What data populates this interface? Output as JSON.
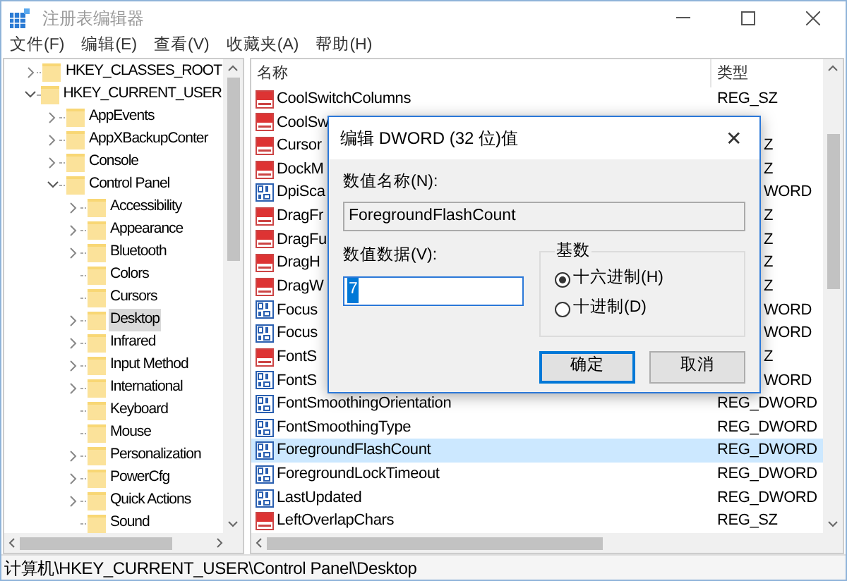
{
  "window": {
    "title": "注册表编辑器",
    "active": false
  },
  "menu": [
    "文件(F)",
    "编辑(E)",
    "查看(V)",
    "收藏夹(A)",
    "帮助(H)"
  ],
  "tree": [
    {
      "label": "HKEY_CLASSES_ROOT",
      "kind": "node",
      "expanded": false,
      "selected": false
    },
    {
      "label": "HKEY_CURRENT_USER",
      "kind": "node",
      "expanded": true,
      "selected": false,
      "children": [
        {
          "label": "AppEvents",
          "kind": "node",
          "expanded": false,
          "selected": false
        },
        {
          "label": "AppXBackupConter",
          "kind": "node",
          "expanded": false,
          "selected": false
        },
        {
          "label": "Console",
          "kind": "node",
          "expanded": false,
          "selected": false
        },
        {
          "label": "Control Panel",
          "kind": "node",
          "expanded": true,
          "selected": false,
          "children": [
            {
              "label": "Accessibility",
              "kind": "node",
              "expanded": false,
              "selected": false
            },
            {
              "label": "Appearance",
              "kind": "node",
              "expanded": false,
              "selected": false
            },
            {
              "label": "Bluetooth",
              "kind": "node",
              "expanded": false,
              "selected": false
            },
            {
              "label": "Colors",
              "kind": "leaf",
              "selected": false
            },
            {
              "label": "Cursors",
              "kind": "leaf",
              "selected": false
            },
            {
              "label": "Desktop",
              "kind": "node",
              "expanded": false,
              "selected": true
            },
            {
              "label": "Infrared",
              "kind": "node",
              "expanded": false,
              "selected": false
            },
            {
              "label": "Input Method",
              "kind": "node",
              "expanded": false,
              "selected": false
            },
            {
              "label": "International",
              "kind": "node",
              "expanded": false,
              "selected": false
            },
            {
              "label": "Keyboard",
              "kind": "leaf",
              "selected": false
            },
            {
              "label": "Mouse",
              "kind": "leaf",
              "selected": false
            },
            {
              "label": "Personalization",
              "kind": "node",
              "expanded": false,
              "selected": false
            },
            {
              "label": "PowerCfg",
              "kind": "node",
              "expanded": false,
              "selected": false
            },
            {
              "label": "Quick Actions",
              "kind": "node",
              "expanded": false,
              "selected": false
            },
            {
              "label": "Sound",
              "kind": "leaf",
              "selected": false
            }
          ]
        }
      ]
    }
  ],
  "table": {
    "columns": [
      "名称",
      "类型"
    ],
    "rows": [
      {
        "name": "CoolSwitchColumns",
        "type": "REG_SZ",
        "kind": "string",
        "covered": false,
        "selected": false
      },
      {
        "name": "CoolSw",
        "kind": "string",
        "selected": false
      },
      {
        "name": "Cursor",
        "type": "Z",
        "kind": "string",
        "covered": true,
        "selected": false
      },
      {
        "name": "DockM",
        "type": "Z",
        "kind": "string",
        "covered": true,
        "selected": false
      },
      {
        "name": "DpiSca",
        "type": "WORD",
        "kind": "binary",
        "covered": true,
        "selected": false
      },
      {
        "name": "DragFr",
        "type": "Z",
        "kind": "string",
        "covered": true,
        "selected": false
      },
      {
        "name": "DragFu",
        "type": "Z",
        "kind": "string",
        "covered": true,
        "selected": false
      },
      {
        "name": "DragH",
        "type": "Z",
        "kind": "string",
        "covered": true,
        "selected": false
      },
      {
        "name": "DragW",
        "type": "Z",
        "kind": "string",
        "covered": true,
        "selected": false
      },
      {
        "name": "Focus",
        "type": "WORD",
        "kind": "binary",
        "covered": true,
        "selected": false
      },
      {
        "name": "Focus",
        "type": "WORD",
        "kind": "binary",
        "covered": true,
        "selected": false
      },
      {
        "name": "FontS",
        "type": "Z",
        "kind": "string",
        "covered": true,
        "selected": false
      },
      {
        "name": "FontS",
        "type": "WORD",
        "kind": "binary",
        "covered": true,
        "selected": false
      },
      {
        "name": "FontSmoothingOrientation",
        "type": "REG_DWORD",
        "kind": "binary",
        "covered": false,
        "selected": false
      },
      {
        "name": "FontSmoothingType",
        "type": "REG_DWORD",
        "kind": "binary",
        "covered": false,
        "selected": false
      },
      {
        "name": "ForegroundFlashCount",
        "type": "REG_DWORD",
        "kind": "binary",
        "covered": false,
        "selected": true
      },
      {
        "name": "ForegroundLockTimeout",
        "type": "REG_DWORD",
        "kind": "binary",
        "covered": false,
        "selected": false
      },
      {
        "name": "LastUpdated",
        "type": "REG_DWORD",
        "kind": "binary",
        "covered": false,
        "selected": false
      },
      {
        "name": "LeftOverlapChars",
        "type": "REG_SZ",
        "kind": "string",
        "covered": false,
        "selected": false
      }
    ]
  },
  "status_bar": "计算机\\HKEY_CURRENT_USER\\Control Panel\\Desktop",
  "dialog": {
    "title": "编辑 DWORD (32 位)值",
    "close": "✕",
    "name_label": "数值名称(N):",
    "name_value": "ForegroundFlashCount",
    "data_label": "数值数据(V):",
    "data_value": "7",
    "base_label": "基数",
    "bases": [
      {
        "label": "十六进制(H)",
        "selected": true
      },
      {
        "label": "十进制(D)",
        "selected": false
      }
    ],
    "buttons": [
      {
        "label": "确定",
        "default": true
      },
      {
        "label": "取消",
        "default": false
      }
    ]
  }
}
